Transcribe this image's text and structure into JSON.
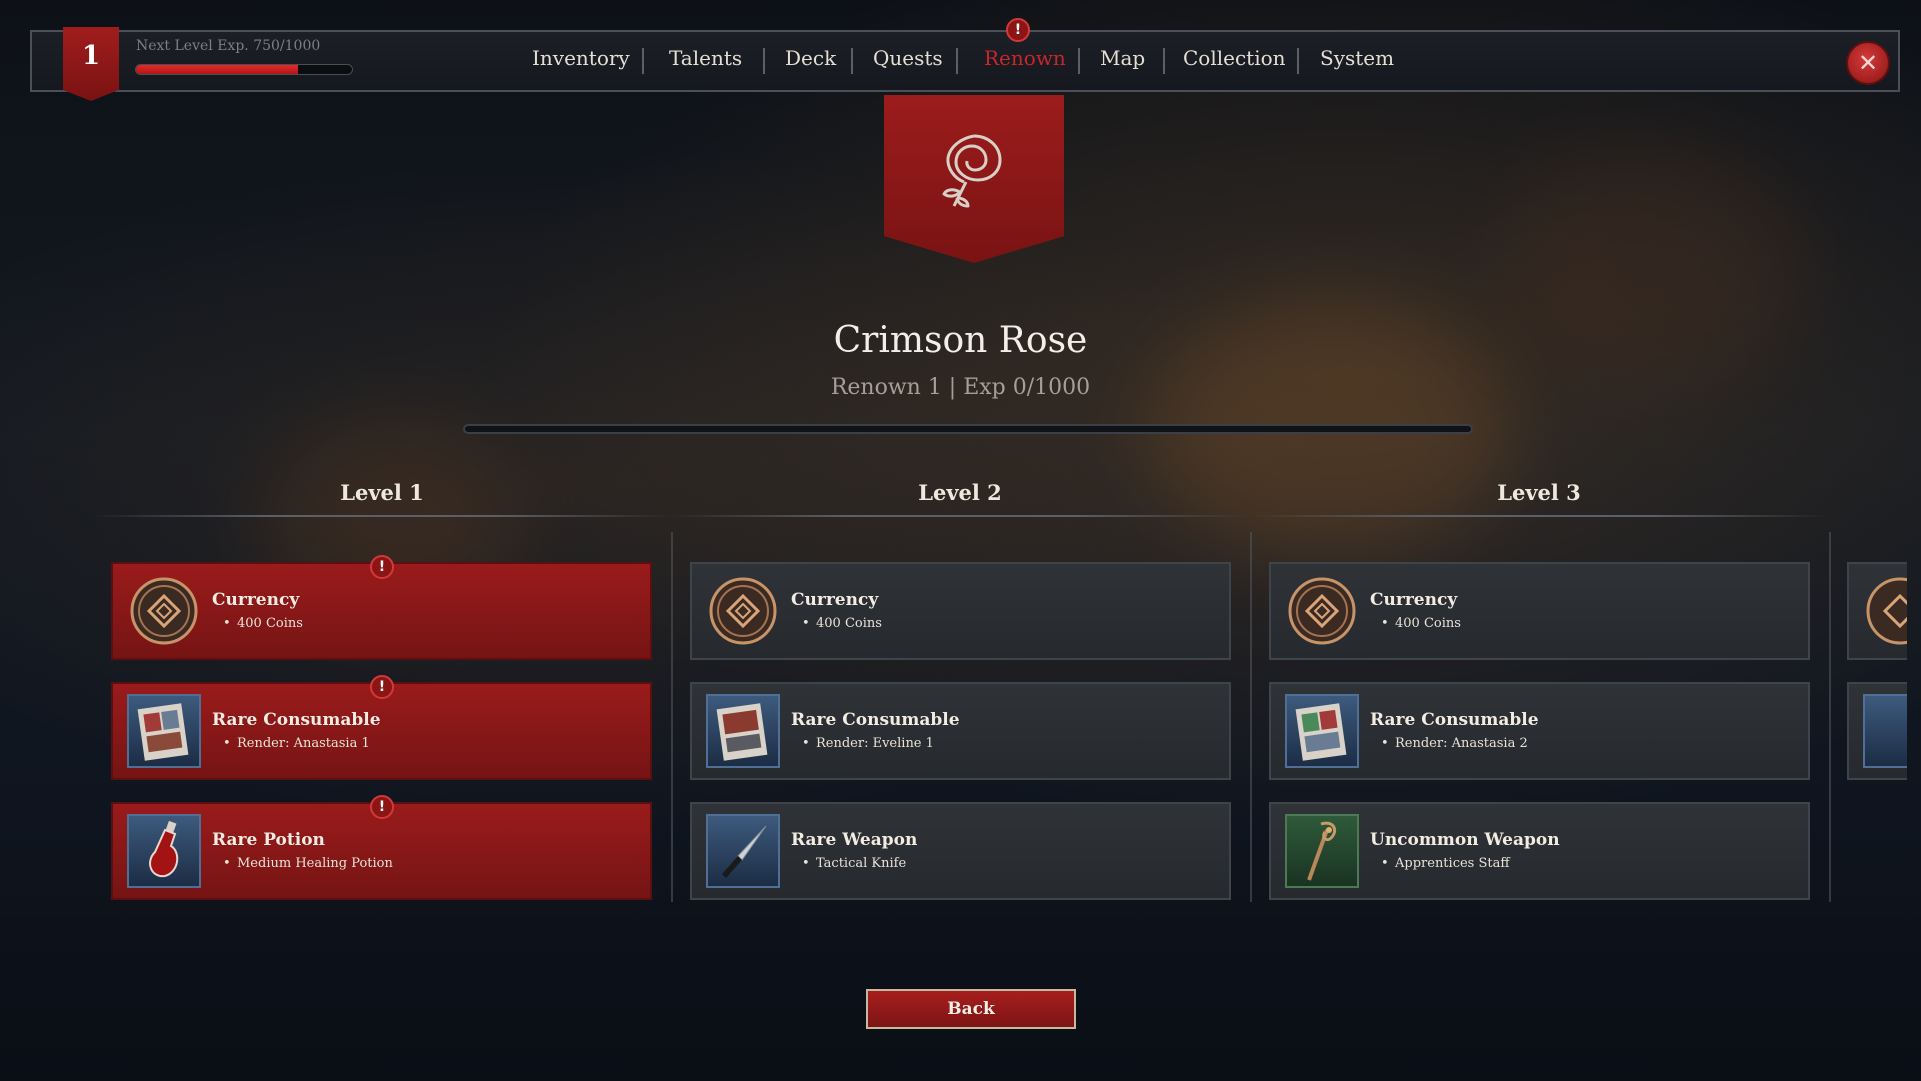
{
  "player": {
    "level": "1",
    "xp_label": "Next Level Exp. 750/1000",
    "xp_progress": 0.75
  },
  "nav": {
    "items": [
      {
        "label": "Inventory"
      },
      {
        "label": "Talents"
      },
      {
        "label": "Deck"
      },
      {
        "label": "Quests"
      },
      {
        "label": "Renown",
        "active": true,
        "alert": "!"
      },
      {
        "label": "Map"
      },
      {
        "label": "Collection"
      },
      {
        "label": "System"
      }
    ]
  },
  "faction": {
    "name": "Crimson Rose",
    "subtitle": "Renown 1 | Exp 0/1000",
    "progress": 0
  },
  "levels": [
    {
      "title": "Level 1",
      "rewards": [
        {
          "category": "Currency",
          "item": "400 Coins",
          "icon": "coin-icon",
          "claimable": true,
          "alert": "!"
        },
        {
          "category": "Rare Consumable",
          "item": "Render: Anastasia 1",
          "icon": "render-card-icon",
          "claimable": true,
          "alert": "!"
        },
        {
          "category": "Rare Potion",
          "item": "Medium Healing Potion",
          "icon": "potion-icon",
          "claimable": true,
          "alert": "!"
        }
      ]
    },
    {
      "title": "Level 2",
      "rewards": [
        {
          "category": "Currency",
          "item": "400 Coins",
          "icon": "coin-icon",
          "claimable": false
        },
        {
          "category": "Rare Consumable",
          "item": "Render: Eveline 1",
          "icon": "render-card-icon",
          "claimable": false
        },
        {
          "category": "Rare Weapon",
          "item": "Tactical Knife",
          "icon": "knife-icon",
          "claimable": false
        }
      ]
    },
    {
      "title": "Level 3",
      "rewards": [
        {
          "category": "Currency",
          "item": "400 Coins",
          "icon": "coin-icon",
          "claimable": false
        },
        {
          "category": "Rare Consumable",
          "item": "Render: Anastasia 2",
          "icon": "render-card-icon",
          "claimable": false
        },
        {
          "category": "Uncommon Weapon",
          "item": "Apprentices Staff",
          "icon": "staff-icon",
          "claimable": false
        }
      ]
    }
  ],
  "buttons": {
    "back": "Back",
    "close_icon": "close-icon"
  },
  "colors": {
    "accent_red": "#9a1b1b",
    "active_tab": "#c8262a",
    "panel": "#2f3237"
  }
}
